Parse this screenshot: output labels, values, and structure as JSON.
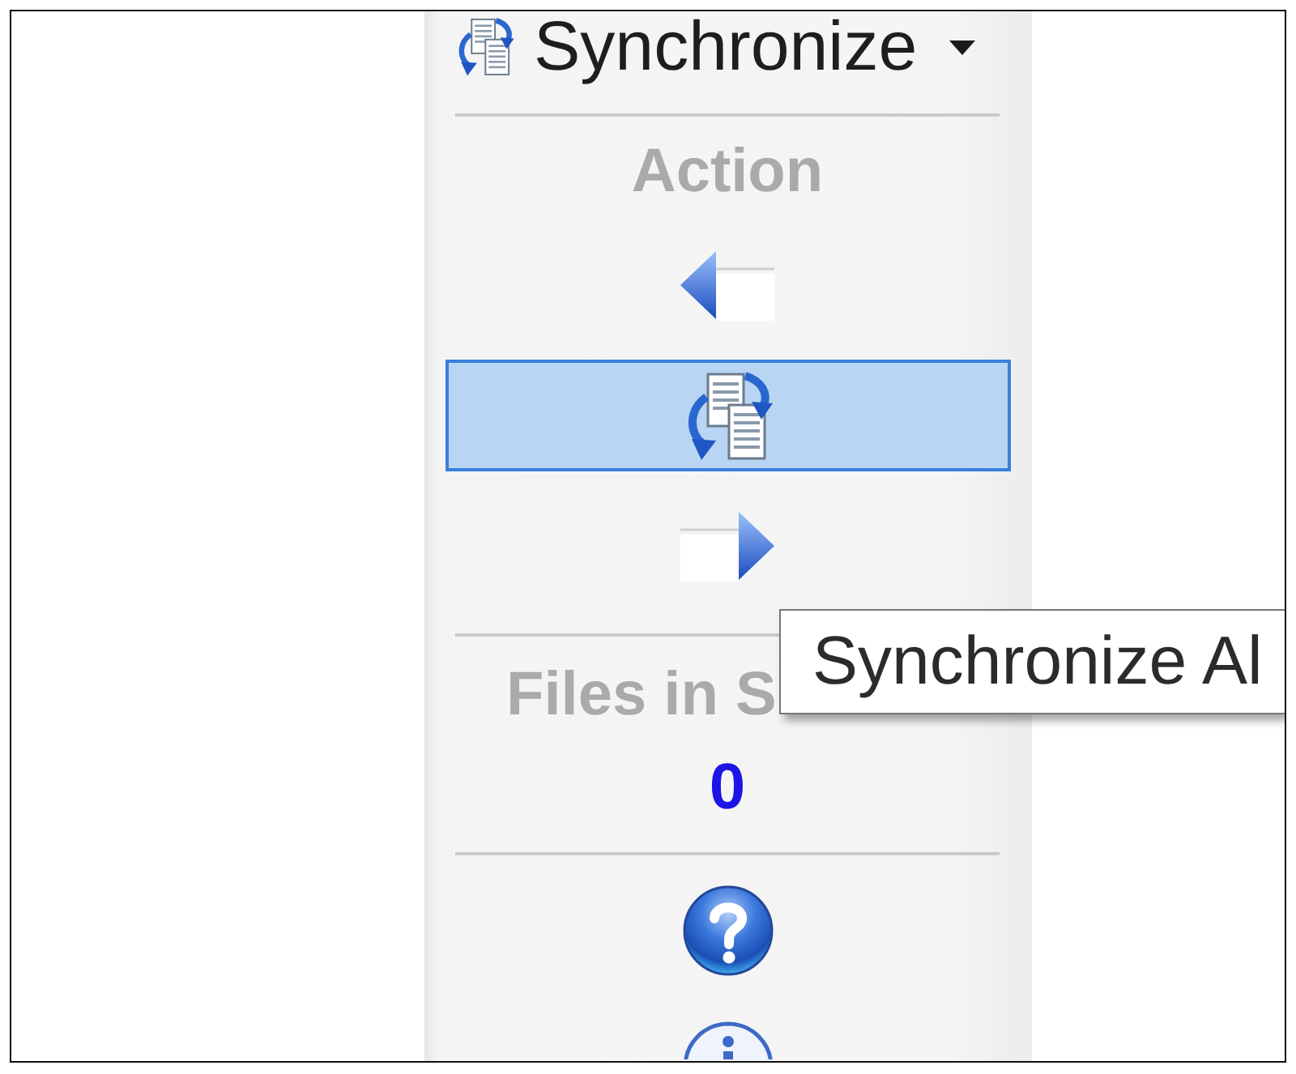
{
  "toolbar": {
    "title": "Synchronize"
  },
  "action": {
    "heading": "Action",
    "buttons": [
      {
        "kind": "left",
        "selected": false
      },
      {
        "kind": "sync",
        "selected": true
      },
      {
        "kind": "right",
        "selected": false
      }
    ]
  },
  "files": {
    "heading": "Files in S",
    "count": "0"
  },
  "help_buttons": [
    {
      "kind": "help"
    },
    {
      "kind": "info"
    }
  ],
  "tooltip": {
    "text": "Synchronize Al"
  }
}
